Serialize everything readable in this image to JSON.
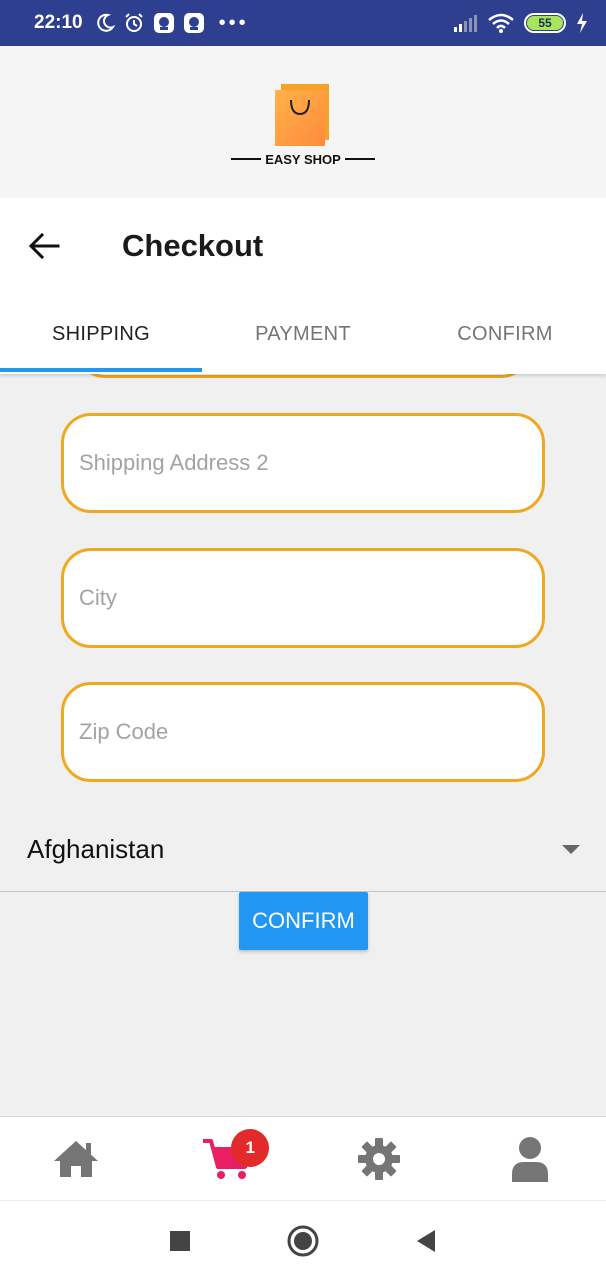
{
  "status_bar": {
    "time": "22:10",
    "battery": "55",
    "icons": [
      "moon-icon",
      "alarm-icon",
      "app-notification-icon",
      "app-notification-icon",
      "signal-icon",
      "wifi-icon",
      "charging-icon"
    ]
  },
  "logo": {
    "text": "EASY SHOP",
    "colors": [
      "#ffb347",
      "#ff8a3d"
    ]
  },
  "app_bar": {
    "title": "Checkout"
  },
  "tabs": [
    {
      "label": "SHIPPING",
      "active": true
    },
    {
      "label": "PAYMENT",
      "active": false
    },
    {
      "label": "CONFIRM",
      "active": false
    }
  ],
  "form": {
    "address2_placeholder": "Shipping Address 2",
    "city_placeholder": "City",
    "zip_placeholder": "Zip Code",
    "country_selected": "Afghanistan",
    "confirm_label": "CONFIRM"
  },
  "bottom_nav": {
    "items": [
      "home-icon",
      "cart-icon",
      "settings-icon",
      "user-icon"
    ],
    "cart_badge": "1",
    "active_color": "#e91e63"
  },
  "colors": {
    "accent": "#2196f3",
    "field_border": "#f0a81e",
    "status_bar": "#2e3f8f"
  }
}
